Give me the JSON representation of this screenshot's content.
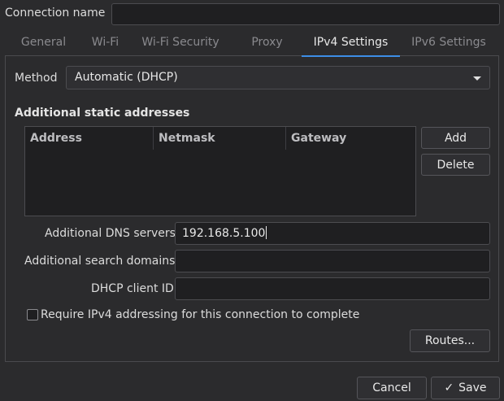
{
  "connection_name": {
    "label": "Connection name",
    "value": ""
  },
  "tabs": [
    {
      "label": "General",
      "active": false
    },
    {
      "label": "Wi-Fi",
      "active": false
    },
    {
      "label": "Wi-Fi Security",
      "active": false
    },
    {
      "label": "Proxy",
      "active": false
    },
    {
      "label": "IPv4 Settings",
      "active": true
    },
    {
      "label": "IPv6 Settings",
      "active": false
    }
  ],
  "method": {
    "label": "Method",
    "value": "Automatic (DHCP)"
  },
  "static_addresses": {
    "heading": "Additional static addresses",
    "columns": [
      "Address",
      "Netmask",
      "Gateway"
    ],
    "rows": [],
    "add_label": "Add",
    "delete_label": "Delete"
  },
  "dns": {
    "label": "Additional DNS servers",
    "value": "192.168.5.100"
  },
  "search_domains": {
    "label": "Additional search domains",
    "value": ""
  },
  "dhcp_client_id": {
    "label": "DHCP client ID",
    "value": ""
  },
  "require_ipv4": {
    "label": "Require IPv4 addressing for this connection to complete",
    "checked": false
  },
  "routes_label": "Routes...",
  "footer": {
    "cancel_label": "Cancel",
    "save_label": "Save",
    "save_icon": "check-icon"
  },
  "colors": {
    "accent": "#3d8ee6",
    "background": "#2b2b2d",
    "field": "#1f1f21"
  }
}
